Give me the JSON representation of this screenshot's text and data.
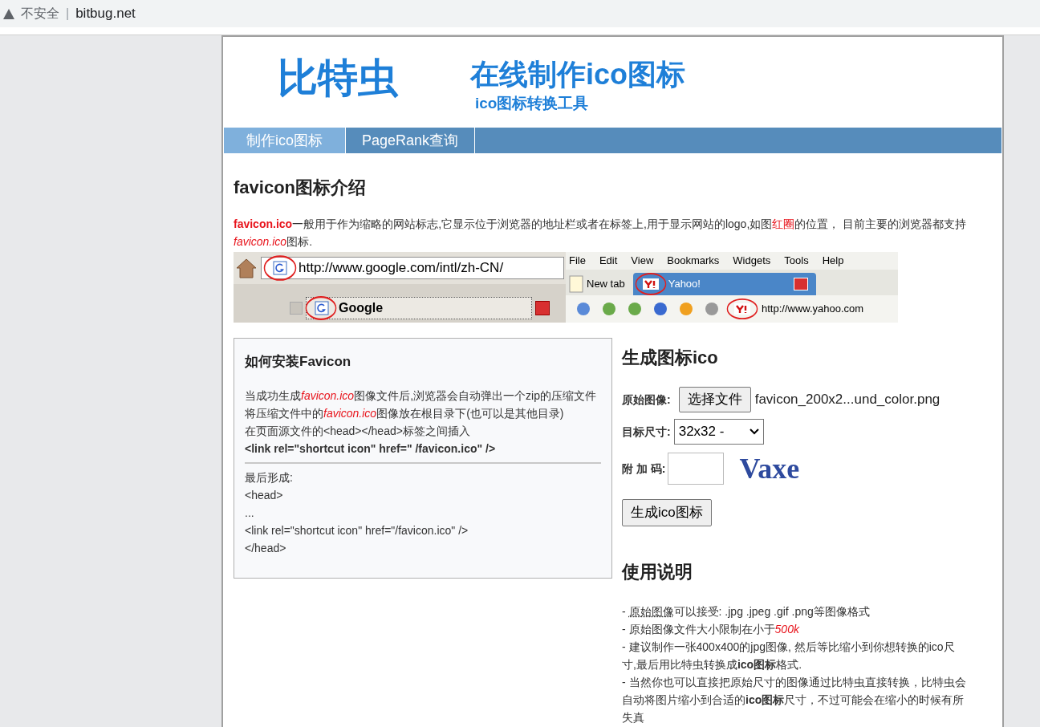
{
  "address_bar": {
    "security": "不安全",
    "separator": "|",
    "url": "bitbug.net"
  },
  "header": {
    "logo": "比特虫",
    "title": "在线制作ico图标",
    "subtitle": "ico图标转换工具"
  },
  "nav": [
    {
      "label": "制作ico图标",
      "selected": true
    },
    {
      "label": "PageRank查询",
      "selected": false
    }
  ],
  "intro": {
    "heading": "favicon图标介绍",
    "text": [
      {
        "kind": "red-bold",
        "text": "favicon.ico"
      },
      {
        "kind": "plain",
        "text": "一般用于作为缩略的网站标志,它显示位于浏览器的地址栏或者在标签上,用于显示网站的logo,如图"
      },
      {
        "kind": "red",
        "text": "红圈"
      },
      {
        "kind": "plain",
        "text": "的位置，  目前主要的浏览器都支持"
      },
      {
        "kind": "red-italic",
        "text": "favicon.ico"
      },
      {
        "kind": "plain",
        "text": "图标."
      }
    ]
  },
  "example": {
    "google_url": "http://www.google.com/intl/zh-CN/",
    "google_tab": "Google",
    "menu": [
      "File",
      "Edit",
      "View",
      "Bookmarks",
      "Widgets",
      "Tools",
      "Help"
    ],
    "tabs": [
      "New tab",
      "Yahoo!"
    ],
    "yahoo_url": "http://www.yahoo.com"
  },
  "install": {
    "heading": "如何安装Favicon",
    "lines": [
      [
        {
          "kind": "plain",
          "text": "当成功生成"
        },
        {
          "kind": "red-italic",
          "text": "favicon.ico"
        },
        {
          "kind": "plain",
          "text": "图像文件后,浏览器会自动弹出一个zip的压缩文件"
        }
      ],
      [
        {
          "kind": "plain",
          "text": "将压缩文件中的"
        },
        {
          "kind": "red-italic",
          "text": "favicon.ico"
        },
        {
          "kind": "plain",
          "text": "图像放在根目录下(也可以是其他目录)"
        }
      ],
      [
        {
          "kind": "plain",
          "text": "在页面源文件的<head></head>标签之间插入"
        }
      ],
      [
        {
          "kind": "bold",
          "text": "<link rel=\"shortcut icon\" href=\" /favicon.ico\" />"
        }
      ]
    ],
    "result": [
      "最后形成:",
      "<head>",
      "...",
      "<link rel=\"shortcut icon\" href=\"/favicon.ico\" />",
      "</head>"
    ]
  },
  "form": {
    "heading": "生成图标ico",
    "image_label": "原始图像:",
    "choose_button": "选择文件",
    "file_name": "favicon_200x2...und_color.png",
    "size_label": "目标尺寸:",
    "size_value": "32x32 -",
    "code_label": "附 加 码:",
    "captcha": "Vaxe",
    "submit": "生成ico图标"
  },
  "usage": {
    "heading": "使用说明",
    "items": [
      [
        {
          "kind": "plain",
          "text": "- "
        },
        {
          "kind": "dotted",
          "text": "原始图像"
        },
        {
          "kind": "plain",
          "text": "可以接受: .jpg .jpeg .gif .png等图像格式"
        }
      ],
      [
        {
          "kind": "plain",
          "text": "- 原始图像文件大小限制在小于"
        },
        {
          "kind": "red-italic",
          "text": "500k"
        }
      ],
      [
        {
          "kind": "plain",
          "text": "- 建议制作一张400x400的jpg图像, 然后等比缩小到你想转换的ico尺寸,最后用比特虫转换成"
        },
        {
          "kind": "bold",
          "text": "ico图标"
        },
        {
          "kind": "plain",
          "text": "格式."
        }
      ],
      [
        {
          "kind": "plain",
          "text": "- 当然你也可以直接把原始尺寸的图像通过比特虫直接转换，比特虫会自动将图片缩小到合适的"
        },
        {
          "kind": "bold",
          "text": "ico图标"
        },
        {
          "kind": "plain",
          "text": "尺寸，不过可能会在缩小的时候有所失真"
        }
      ]
    ]
  }
}
